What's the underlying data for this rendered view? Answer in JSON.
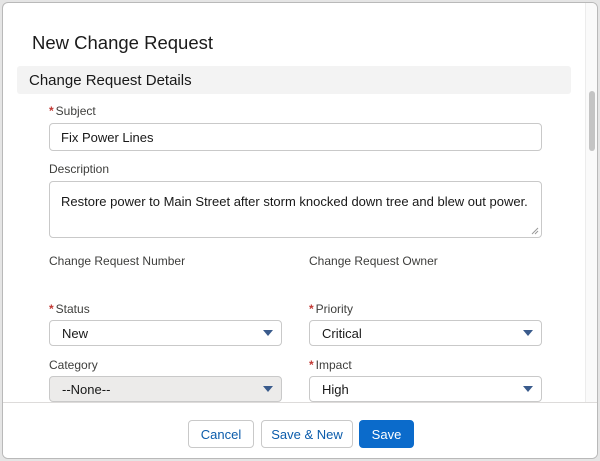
{
  "modal": {
    "title": "New Change Request"
  },
  "section": {
    "title": "Change Request Details"
  },
  "fields": {
    "subject": {
      "label": "Subject",
      "required_mark": "*",
      "value": "Fix Power Lines"
    },
    "description": {
      "label": "Description",
      "value": "Restore power to Main Street after storm knocked down tree and blew out power."
    },
    "number": {
      "label": "Change Request Number"
    },
    "owner": {
      "label": "Change Request Owner"
    },
    "status": {
      "label": "Status",
      "required_mark": "*",
      "value": "New"
    },
    "priority": {
      "label": "Priority",
      "required_mark": "*",
      "value": "Critical"
    },
    "category": {
      "label": "Category",
      "value": "--None--"
    },
    "impact": {
      "label": "Impact",
      "required_mark": "*",
      "value": "High"
    }
  },
  "footer": {
    "cancel_label": "Cancel",
    "save_new_label": "Save & New",
    "save_label": "Save"
  },
  "icons": {
    "dropdown": "chevron-down-icon",
    "resize": "resize-handle-icon"
  },
  "colors": {
    "brand": "#0b6bcb",
    "required": "#c23934",
    "caret": "#3a5b8c"
  }
}
